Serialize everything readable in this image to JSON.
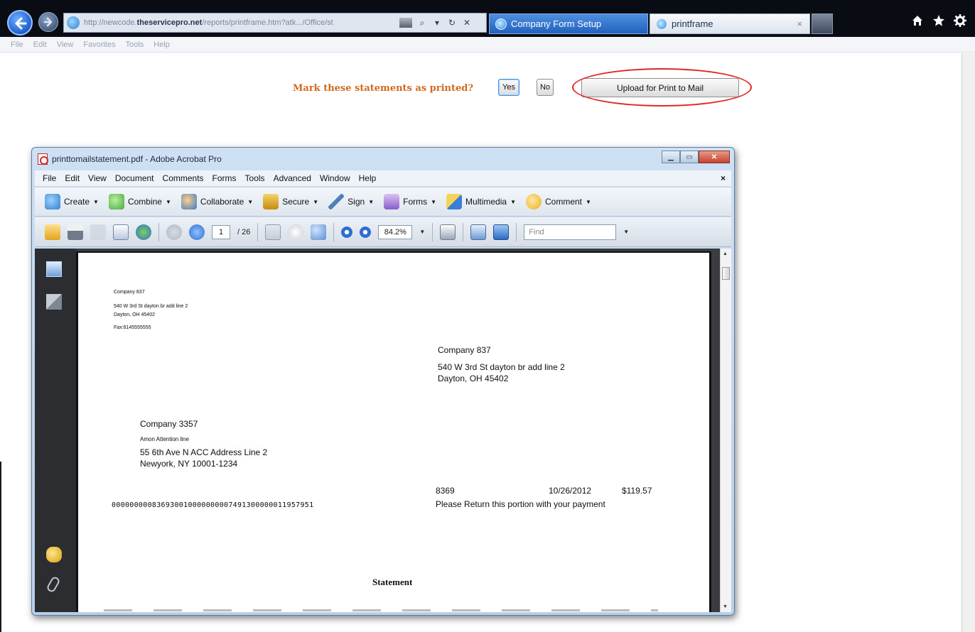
{
  "browser": {
    "address_prefix": "http://newcode.",
    "address_domain": "theservicepro.net",
    "address_path": "/reports/printframe.htm?atk.../Office/st",
    "tabs": [
      {
        "label": "Company Form Setup"
      },
      {
        "label": "printframe",
        "close": "×"
      }
    ],
    "menu": [
      "File",
      "Edit",
      "View",
      "Favorites",
      "Tools",
      "Help"
    ],
    "tools": {
      "search": "⌕",
      "dropdown": "▾",
      "refresh": "↻",
      "stop": "✕"
    }
  },
  "page": {
    "mark_question": "Mark these statements as printed?",
    "yes_label": "Yes",
    "no_label": "No",
    "upload_label": "Upload for Print to Mail"
  },
  "acrobat": {
    "title": "printtomailstatement.pdf - Adobe Acrobat Pro",
    "menu": [
      "File",
      "Edit",
      "View",
      "Document",
      "Comments",
      "Forms",
      "Tools",
      "Advanced",
      "Window",
      "Help"
    ],
    "doc_close": "×",
    "tasks": [
      {
        "label": "Create",
        "icon": "create-pdf-icon",
        "color": "#2f7fd0"
      },
      {
        "label": "Combine",
        "icon": "combine-icon",
        "color": "#4aa83a"
      },
      {
        "label": "Collaborate",
        "icon": "collaborate-icon",
        "color": "#3b78c8"
      },
      {
        "label": "Secure",
        "icon": "lock-icon",
        "color": "#d6a020"
      },
      {
        "label": "Sign",
        "icon": "pen-icon",
        "color": "#4f7fb8"
      },
      {
        "label": "Forms",
        "icon": "forms-icon",
        "color": "#8a5cc8"
      },
      {
        "label": "Multimedia",
        "icon": "multimedia-icon",
        "color": "#e0b020"
      },
      {
        "label": "Comment",
        "icon": "comment-icon",
        "color": "#e8b020"
      }
    ],
    "toolbar": {
      "page_current": "1",
      "page_total": "/ 26",
      "zoom": "84.2%",
      "find_placeholder": "Find"
    }
  },
  "pdf": {
    "sender": {
      "name": "Company 837",
      "address1": "540 W 3rd St  dayton br add line  2",
      "address2": "Dayton, OH 45402",
      "fax": "Fax:6145555555"
    },
    "remit_to": {
      "name": "Company 837",
      "address1": "540 W 3rd St  dayton br add line  2",
      "address2": "Dayton, OH 45402"
    },
    "recipient": {
      "name": "Company 3357",
      "attention": "Amon Attention line",
      "address1": "55 6th Ave N ACC Address Line 2",
      "address2": "Newyork, NY 10001-1234"
    },
    "micr": "000000000836930010000000007491300000011957951",
    "remit": {
      "account": "8369",
      "date": "10/26/2012",
      "amount": "$119.57",
      "note": "Please Return this portion with your payment"
    },
    "statement_title": "Statement"
  }
}
